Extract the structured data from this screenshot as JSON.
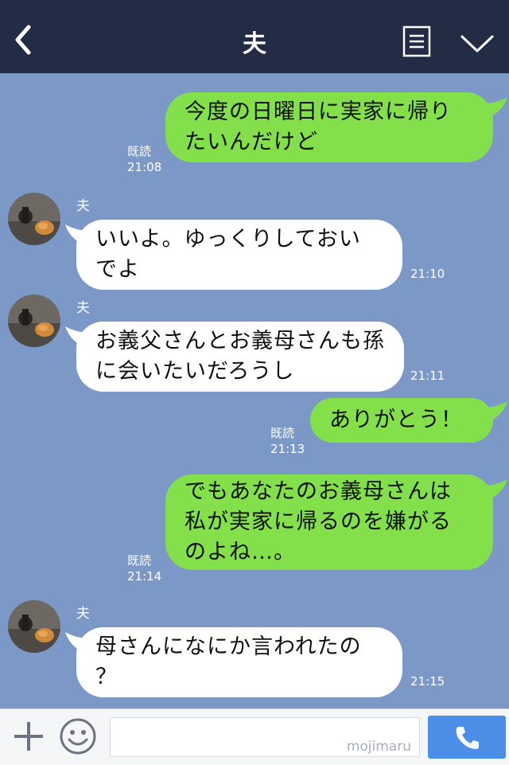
{
  "header": {
    "title": "夫"
  },
  "messages": [
    {
      "side": "me",
      "text": "今度の日曜日に実家に帰り\nたいんだけど",
      "read": "既読",
      "time": "21:08"
    },
    {
      "side": "other",
      "sender": "夫",
      "text": "いいよ。ゆっくりしておい\nでよ",
      "time": "21:10"
    },
    {
      "side": "other",
      "sender": "夫",
      "text": "お義父さんとお義母さんも孫\nに会いたいだろうし",
      "time": "21:11"
    },
    {
      "side": "me",
      "text": "ありがとう！",
      "read": "既読",
      "time": "21:13"
    },
    {
      "side": "me",
      "text": "でもあなたのお義母さんは\n私が実家に帰るのを嫌がる\nのよね…。",
      "read": "既読",
      "time": "21:14"
    },
    {
      "side": "other",
      "sender": "夫",
      "text": "母さんになにか言われたの\n？",
      "time": "21:15"
    }
  ],
  "input": {
    "watermark": "mojimaru"
  },
  "colors": {
    "header_bg": "#222c45",
    "chat_bg": "#7b98c7",
    "my_bubble": "#84e04a",
    "other_bubble": "#ffffff",
    "call_button": "#4a8ee8"
  },
  "icons": [
    "back-arrow-icon",
    "menu-icon",
    "chevron-down-icon",
    "plus-icon",
    "smile-icon",
    "phone-icon",
    "avatar"
  ]
}
